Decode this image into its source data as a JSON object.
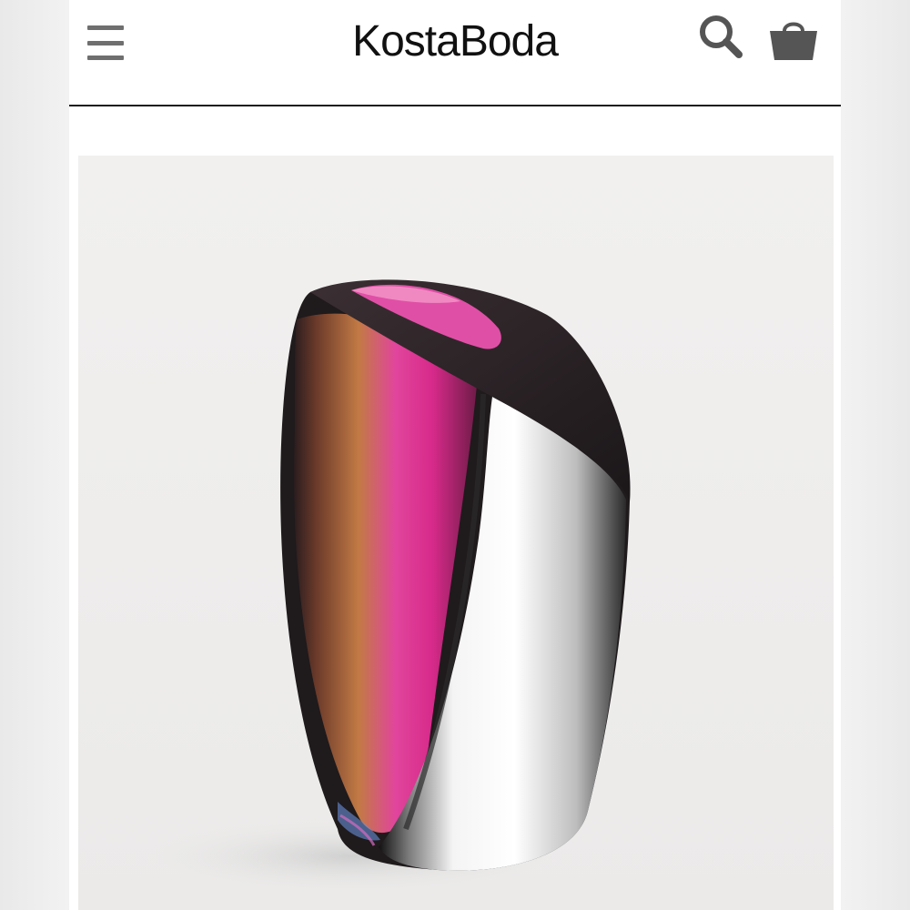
{
  "header": {
    "brand": "KostaBoda",
    "menu_icon": "hamburger-menu-icon",
    "search_icon": "search-icon",
    "cart_icon": "shopping-bag-icon"
  },
  "product": {
    "image_subject": "vase-image",
    "colors": {
      "accent_pink": "#e0319a",
      "amber": "#b06a3a",
      "background": "#f0efee"
    }
  }
}
